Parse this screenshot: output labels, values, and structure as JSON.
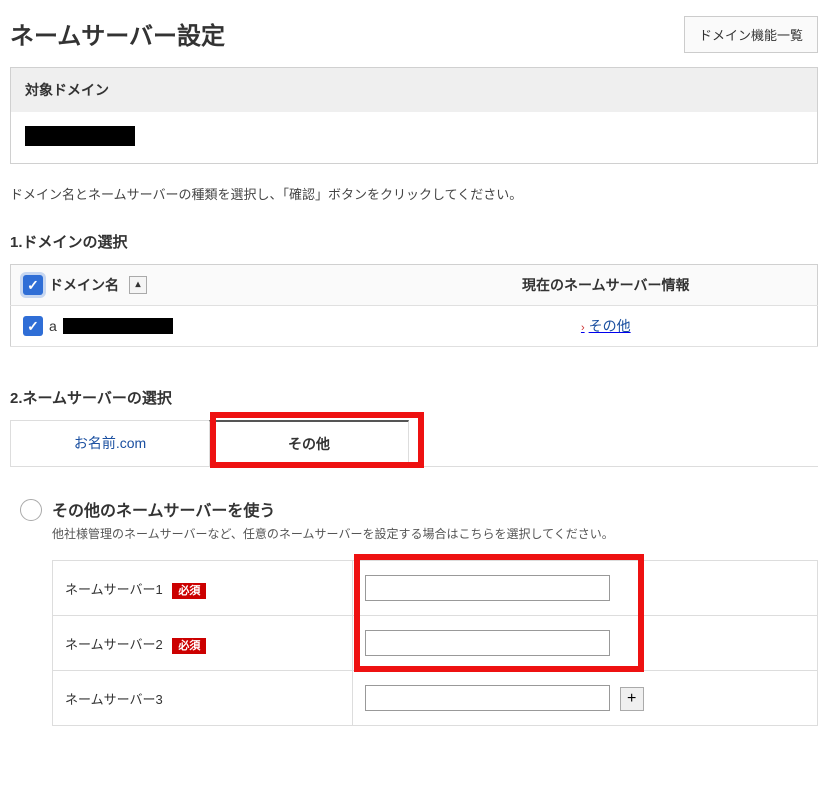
{
  "header": {
    "title": "ネームサーバー設定",
    "list_button": "ドメイン機能一覧"
  },
  "target_domain_panel": {
    "label": "対象ドメイン"
  },
  "instruction": "ドメイン名とネームサーバーの種類を選択し、「確認」ボタンをクリックしてください。",
  "section1": {
    "title": "1.ドメインの選択",
    "col_domain": "ドメイン名",
    "col_info": "現在のネームサーバー情報",
    "row0_prefix": "a",
    "row0_info": "その他"
  },
  "section2": {
    "title": "2.ネームサーバーの選択",
    "tab_onamae": "お名前.com",
    "tab_other": "その他"
  },
  "other_ns": {
    "title": "その他のネームサーバーを使う",
    "desc": "他社様管理のネームサーバーなど、任意のネームサーバーを設定する場合はこちらを選択してください。",
    "required": "必須",
    "ns1_label": "ネームサーバー1",
    "ns2_label": "ネームサーバー2",
    "ns3_label": "ネームサーバー3"
  }
}
